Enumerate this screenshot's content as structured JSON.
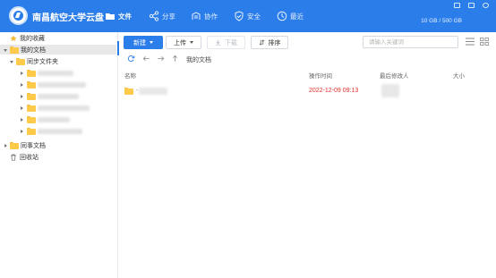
{
  "header": {
    "brand": "南昌航空大学云盘",
    "nav": [
      {
        "label": "文件",
        "icon": "folder-icon"
      },
      {
        "label": "分享",
        "icon": "share-icon"
      },
      {
        "label": "协作",
        "icon": "collab-icon"
      },
      {
        "label": "安全",
        "icon": "shield-icon"
      },
      {
        "label": "最近",
        "icon": "clock-icon"
      }
    ],
    "quota": "10 GB / 500 GB",
    "colors": {
      "bar": "#2b7de9"
    }
  },
  "sidebar": {
    "favorites": "我的收藏",
    "my_docs": "我的文档",
    "sync_folder": "同步文件夹",
    "colleague_docs": "同事文档",
    "recycle_bin": "回收站"
  },
  "toolbar": {
    "new_label": "新建",
    "upload_label": "上传",
    "download_label": "下载",
    "sort_label": "排序",
    "search_placeholder": "请输入关键词"
  },
  "breadcrumb": {
    "path": "我的文档"
  },
  "table": {
    "columns": {
      "name": "名称",
      "modified": "操作时间",
      "last_modifier": "最后修改人",
      "size": "大小"
    },
    "rows": [
      {
        "name": ".",
        "modified": "2022-12-09 09:13"
      }
    ]
  }
}
